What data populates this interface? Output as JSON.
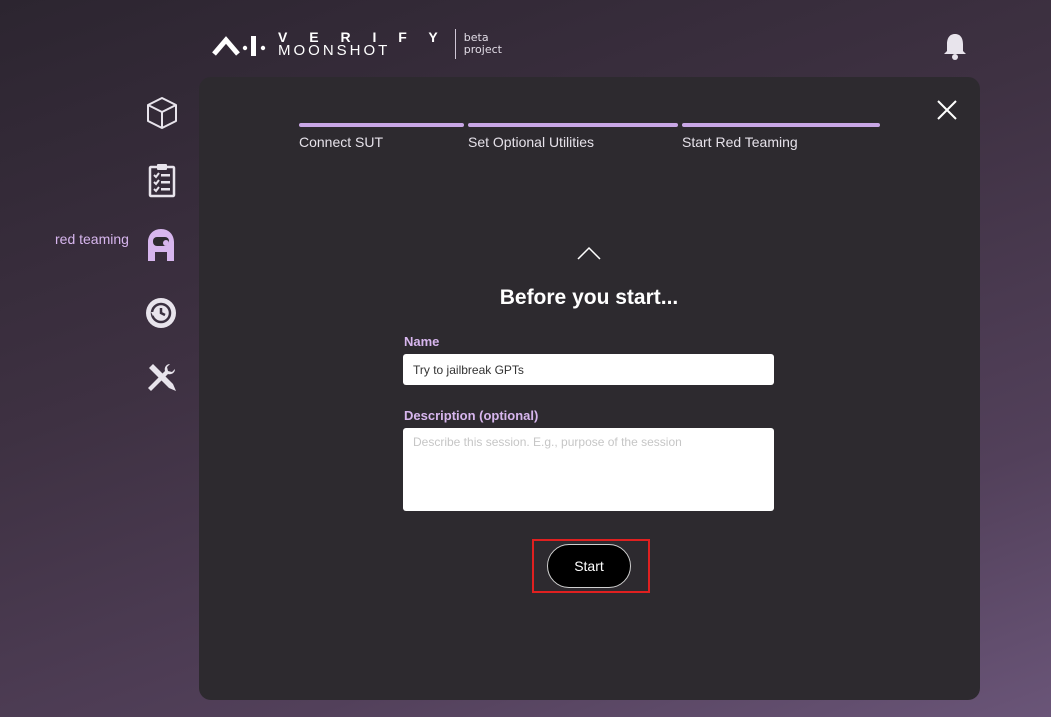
{
  "header": {
    "logo_verify": "V E R I F Y",
    "logo_moonshot": "MOONSHOT",
    "logo_beta": "beta",
    "logo_project": "project"
  },
  "sidebar": {
    "items": [
      {
        "icon": "cube-icon"
      },
      {
        "icon": "clipboard-list-icon"
      },
      {
        "icon": "red-teaming-avatar-icon",
        "label": "red teaming",
        "active": true
      },
      {
        "icon": "history-icon"
      },
      {
        "icon": "tools-icon"
      }
    ]
  },
  "steps": [
    {
      "label": "Connect SUT"
    },
    {
      "label": "Set Optional Utilities"
    },
    {
      "label": "Start Red Teaming"
    }
  ],
  "form": {
    "title": "Before you start...",
    "name_label": "Name",
    "name_value": "Try to jailbreak GPTs",
    "description_label": "Description (optional)",
    "description_placeholder": "Describe this session. E.g., purpose of the session",
    "start_label": "Start"
  },
  "colors": {
    "accent": "#c9a7e6",
    "label": "#d7b6ee",
    "panel": "#2d2a2f",
    "highlight": "#e02020"
  }
}
